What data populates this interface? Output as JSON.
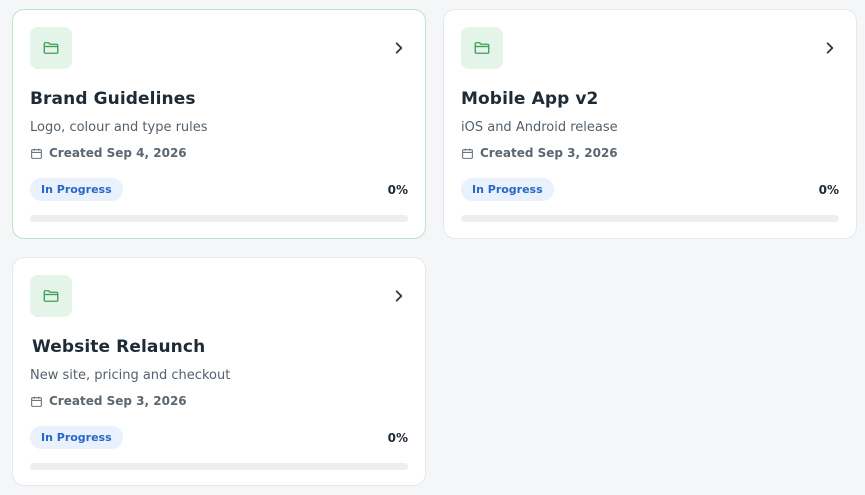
{
  "projects": [
    {
      "title": "Brand Guidelines",
      "description": "Logo, colour and type rules",
      "created": "Created Sep 4, 2026",
      "status": "In Progress",
      "progress_label": "0%",
      "progress": 0
    },
    {
      "title": "Mobile App v2",
      "description": "iOS and Android release",
      "created": "Created Sep 3, 2026",
      "status": "In Progress",
      "progress_label": "0%",
      "progress": 0
    },
    {
      "title": "Website Relaunch",
      "description": "New site, pricing and checkout",
      "created": "Created Sep 3, 2026",
      "status": "In Progress",
      "progress_label": "0%",
      "progress": 0
    }
  ],
  "icons": {
    "folder": "folder-icon",
    "open": "chevron-right-icon",
    "date": "calendar-icon"
  },
  "colors": {
    "accent_green": "#3f9d5a",
    "icon_bg": "#e4f4e8",
    "badge_bg": "#e9f1fd",
    "badge_text": "#2a66c9",
    "progress_track": "#eceef1"
  }
}
